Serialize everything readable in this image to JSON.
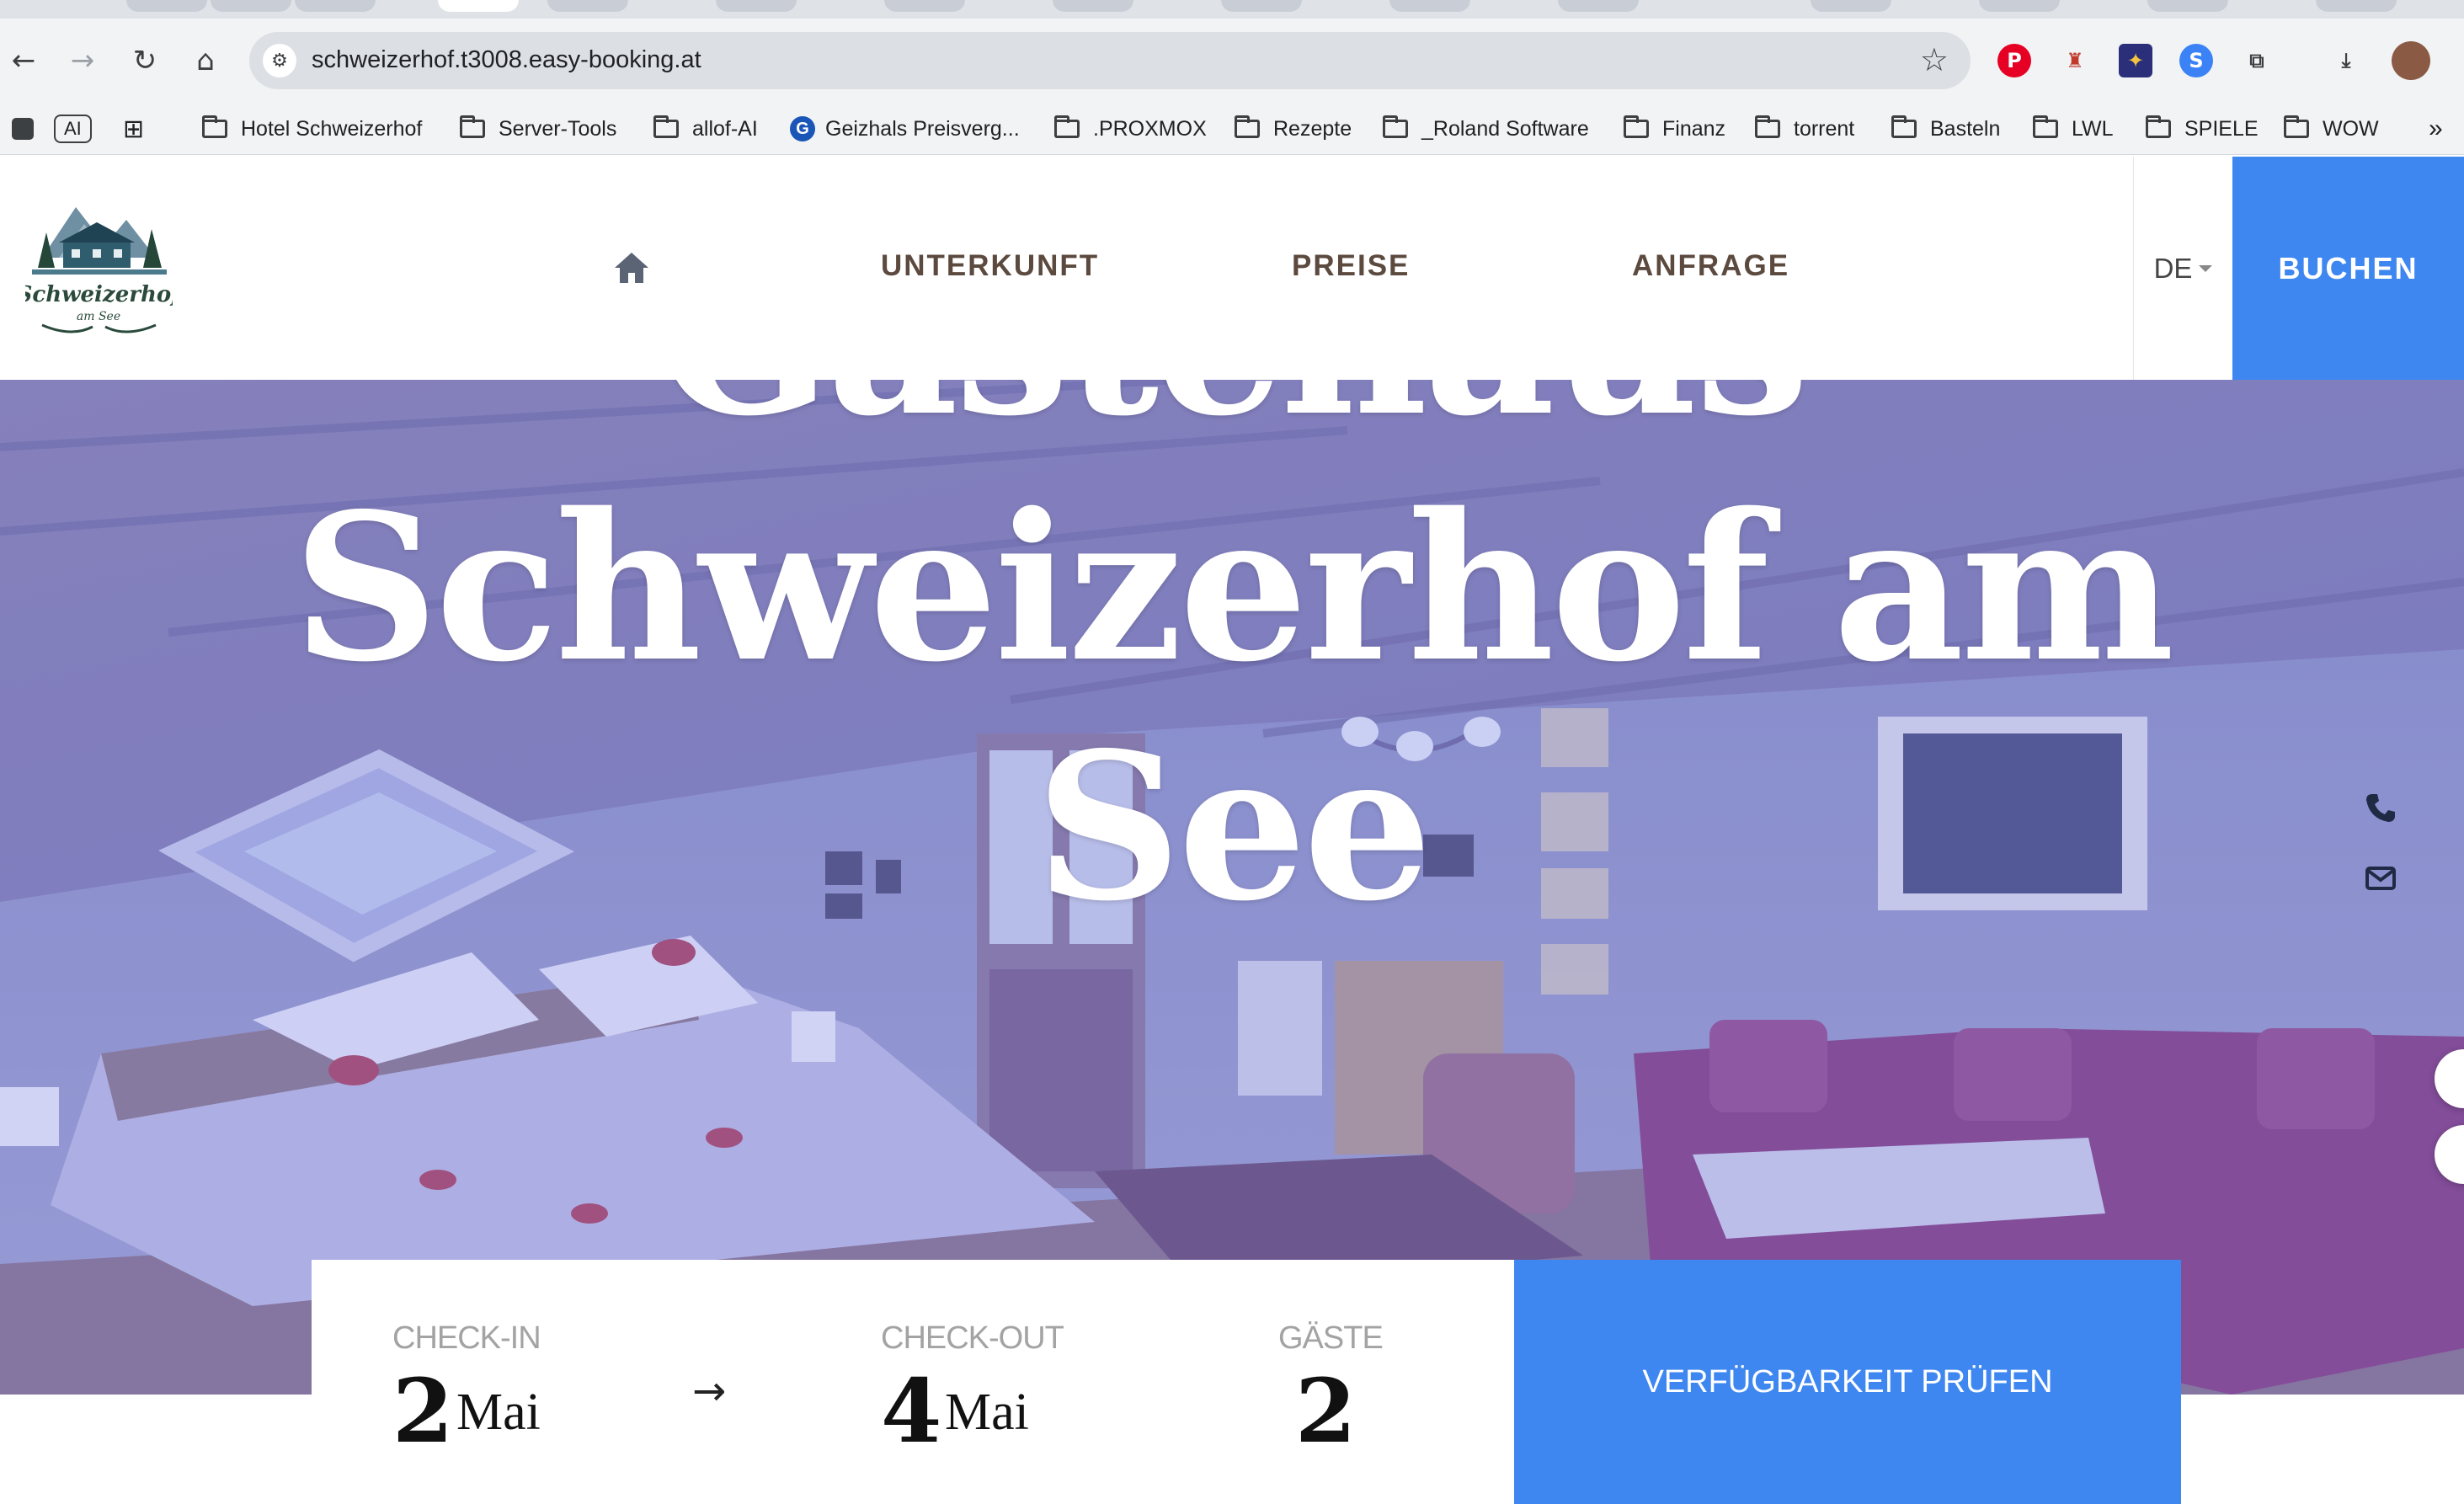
{
  "browser": {
    "url": "schweizerhof.t3008.easy-booking.at",
    "bookmarks": [
      {
        "label": "AI",
        "type": "badge"
      },
      {
        "label": "Hotel Schweizerhof",
        "type": "folder"
      },
      {
        "label": "Server-Tools",
        "type": "folder"
      },
      {
        "label": "allof-AI",
        "type": "folder"
      },
      {
        "label": "Geizhals Preisverg...",
        "type": "site"
      },
      {
        "label": ".PROXMOX",
        "type": "folder"
      },
      {
        "label": "Rezepte",
        "type": "folder"
      },
      {
        "label": "_Roland Software",
        "type": "folder"
      },
      {
        "label": "Finanz",
        "type": "folder"
      },
      {
        "label": "torrent",
        "type": "folder"
      },
      {
        "label": "Basteln",
        "type": "folder"
      },
      {
        "label": "LWL",
        "type": "folder"
      },
      {
        "label": "SPIELE",
        "type": "folder"
      },
      {
        "label": "WOW",
        "type": "folder"
      }
    ],
    "icons": [
      "back-icon",
      "forward-icon",
      "reload-icon",
      "home-icon",
      "site-settings-icon",
      "bookmark-star-icon",
      "pinterest-icon",
      "extension-icon",
      "downloads-icon",
      "profile-avatar"
    ]
  },
  "site": {
    "logo": {
      "line1": "Schweizerhof",
      "line2": "am See"
    },
    "nav": {
      "home_icon": "home-icon",
      "unterkunft": "UNTERKUNFT",
      "preise": "PREISE",
      "anfrage": "ANFRAGE"
    },
    "language": "DE",
    "book_label": "BUCHEN",
    "accent_color": "#3f87f0",
    "nav_text_color": "#5c4a3f"
  },
  "hero": {
    "title_line1": "Gästehaus",
    "title_line2": "Schweizerhof am",
    "title_line3": "See",
    "side_icons": [
      "phone-icon",
      "mail-icon"
    ]
  },
  "booking": {
    "checkin_label": "CHECK-IN",
    "checkin_day": "2",
    "checkin_month": "Mai",
    "checkout_label": "CHECK-OUT",
    "checkout_day": "4",
    "checkout_month": "Mai",
    "guests_label": "GÄSTE",
    "guests_value": "2",
    "submit_label": "VERFÜGBARKEIT PRÜFEN"
  }
}
